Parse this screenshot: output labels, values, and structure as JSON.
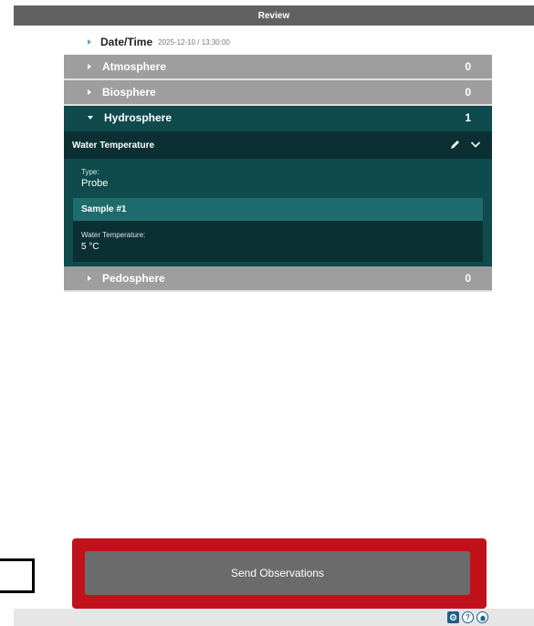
{
  "header": {
    "title": "Review"
  },
  "datetime": {
    "label": "Date/Time",
    "value": "2025-12-10 / 13:30:00"
  },
  "sections": [
    {
      "name": "Atmosphere",
      "count": "0",
      "expanded": false
    },
    {
      "name": "Biosphere",
      "count": "0",
      "expanded": false
    },
    {
      "name": "Hydrosphere",
      "count": "1",
      "expanded": true
    },
    {
      "name": "Pedosphere",
      "count": "0",
      "expanded": false
    }
  ],
  "observation": {
    "title": "Water Temperature",
    "type_label": "Type:",
    "type_value": "Probe",
    "sample_title": "Sample #1",
    "sample_field_label": "Water Temperature:",
    "sample_field_value": "5 °C"
  },
  "actions": {
    "send_label": "Send Observations"
  },
  "footer": {
    "icons": [
      "gear-icon",
      "help-icon",
      "home-icon"
    ],
    "help_glyph": "?"
  },
  "colors": {
    "header_bg": "#616161",
    "section_gray": "#9e9e9e",
    "teal_dark": "#0f4a4d",
    "teal_darker": "#0b3033",
    "teal_mid": "#1f6c6e",
    "highlight_red": "#c1121b",
    "button_gray": "#6b6b6b"
  }
}
